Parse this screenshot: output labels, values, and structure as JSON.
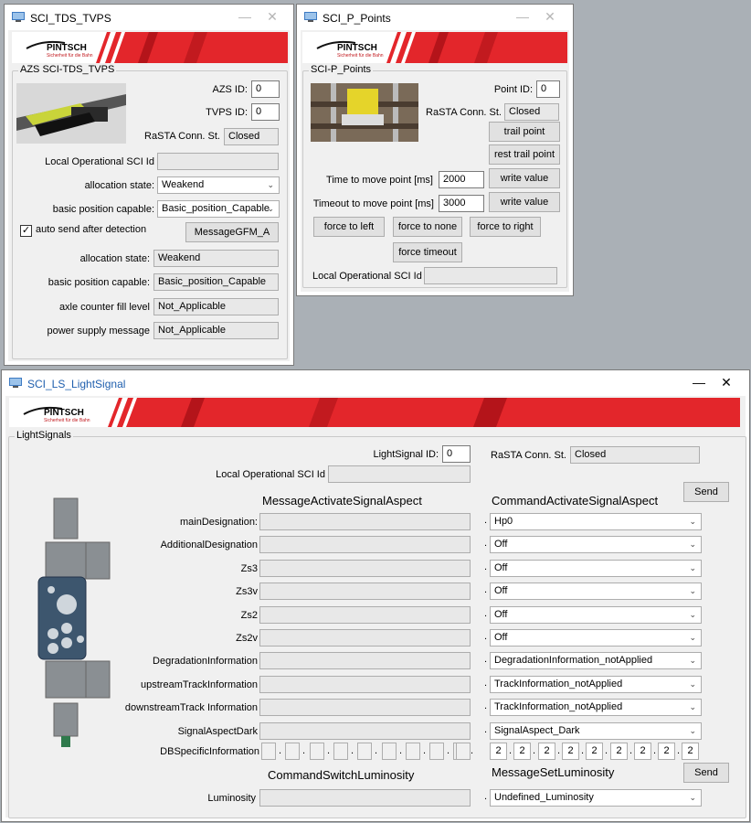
{
  "brand": {
    "name": "PINTSCH",
    "tagline": "Sicherheit für die Bahn"
  },
  "tds": {
    "title": "SCI_TDS_TVPS",
    "group": "AZS SCI-TDS_TVPS",
    "azs_id_label": "AZS ID:",
    "azs_id": "0",
    "tvps_id_label": "TVPS ID:",
    "tvps_id": "0",
    "rasta_label": "RaSTA Conn. St.",
    "rasta": "Closed",
    "local_sci_label": "Local Operational SCI Id",
    "local_sci": "",
    "alloc_label": "allocation state:",
    "alloc_value": "Weakend",
    "basic_label": "basic position capable:",
    "basic_value": "Basic_position_Capable",
    "auto_send_label": "auto send after detection",
    "gfm_button": "MessageGFM_A",
    "alloc2_label": "allocation state:",
    "alloc2_value": "Weakend",
    "basic2_label": "basic position capable:",
    "basic2_value": "Basic_position_Capable",
    "axle_label": "axle counter fill level",
    "axle_value": "Not_Applicable",
    "power_label": "power supply message",
    "power_value": "Not_Applicable"
  },
  "points": {
    "title": "SCI_P_Points",
    "group": "SCI-P_Points",
    "point_id_label": "Point ID:",
    "point_id": "0",
    "rasta_label": "RaSTA Conn. St.",
    "rasta": "Closed",
    "trail_btn": "trail point",
    "rest_trail_btn": "rest trail point",
    "time_label": "Time to move point [ms]",
    "time_value": "2000",
    "timeout_label": "Timeout to move point [ms]",
    "timeout_value": "3000",
    "write_btn": "write value",
    "force_left": "force to left",
    "force_none": "force to none",
    "force_right": "force to right",
    "force_timeout": "force timeout",
    "local_sci_label": "Local Operational SCI Id",
    "local_sci": ""
  },
  "ls": {
    "title": "SCI_LS_LightSignal",
    "group": "LightSignals",
    "ls_id_label": "LightSignal ID:",
    "ls_id": "0",
    "rasta_label": "RaSTA Conn. St.",
    "rasta": "Closed",
    "local_sci_label": "Local Operational SCI Id",
    "msg_header": "MessageActivateSignalAspect",
    "cmd_header": "CommandActivateSignalAspect",
    "send_btn": "Send",
    "rows": [
      {
        "label": "mainDesignation:",
        "value": "Hp0"
      },
      {
        "label": "AdditionalDesignation",
        "value": "Off"
      },
      {
        "label": "Zs3",
        "value": "Off"
      },
      {
        "label": "Zs3v",
        "value": "Off"
      },
      {
        "label": "Zs2",
        "value": "Off"
      },
      {
        "label": "Zs2v",
        "value": "Off"
      },
      {
        "label": "DegradationInformation",
        "value": "DegradationInformation_notApplied"
      },
      {
        "label": "upstreamTrackInformation",
        "value": "TrackInformation_notApplied"
      },
      {
        "label": "downstreamTrack Information",
        "value": "TrackInformation_notApplied"
      },
      {
        "label": "SignalAspectDark",
        "value": "SignalAspect_Dark"
      }
    ],
    "db_label": "DBSpecificInformation",
    "db_values": [
      "2",
      "2",
      "2",
      "2",
      "2",
      "2",
      "2",
      "2",
      "2"
    ],
    "switch_header": "CommandSwitchLuminosity",
    "set_header": "MessageSetLuminosity",
    "send2_btn": "Send",
    "lum_label": "Luminosity",
    "lum_value": "Undefined_Luminosity"
  },
  "icons": {
    "minimize": "—",
    "close": "✕",
    "dropdown": "⌄",
    "check": "✓"
  }
}
